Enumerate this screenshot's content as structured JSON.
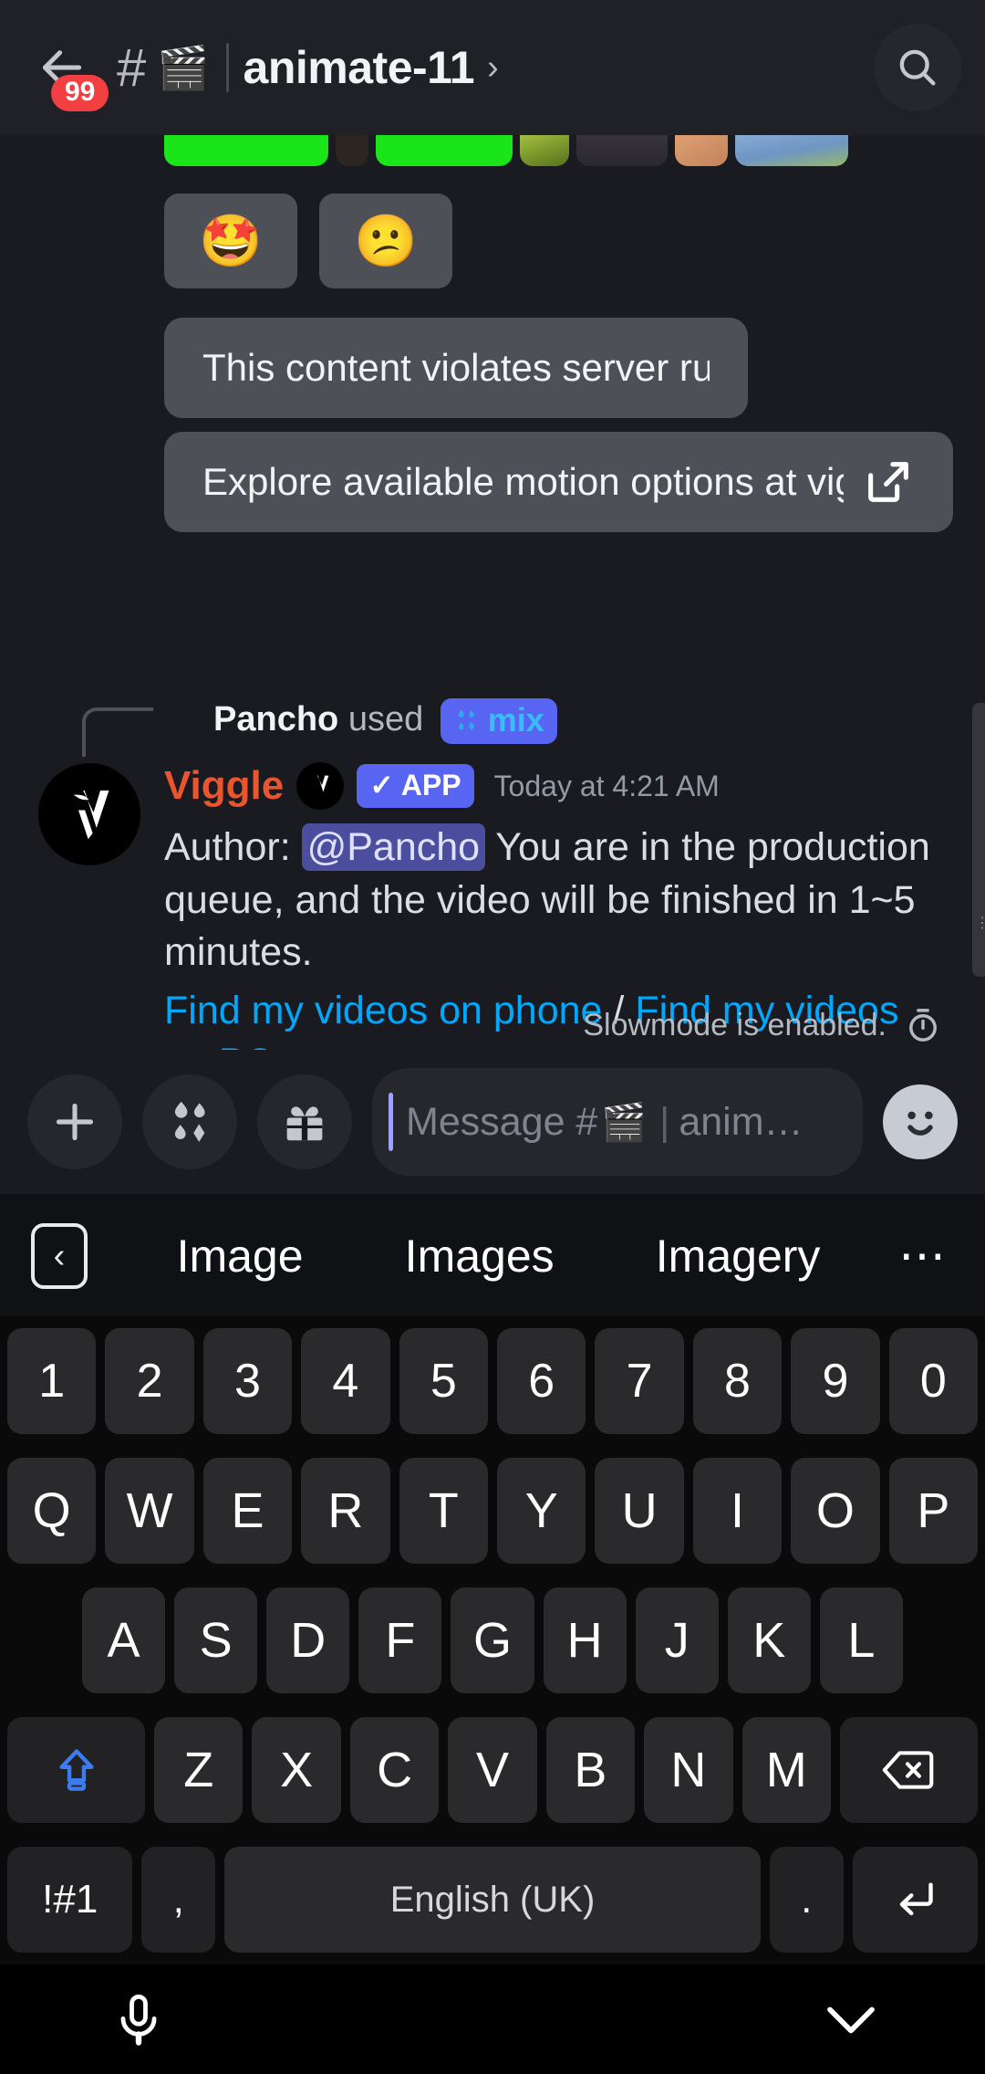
{
  "header": {
    "back_icon": "back-arrow-icon",
    "unread_badge": "99",
    "hash_icon": "#",
    "channel_emoji": "🎬",
    "channel_name": "animate-11",
    "chevron": "›",
    "search_icon": "search-icon"
  },
  "messages": {
    "reactions": [
      {
        "emoji": "🤩",
        "name": "star-struck"
      },
      {
        "emoji": "😕",
        "name": "confused-face"
      }
    ],
    "bubbles": [
      {
        "text": "This content violates server rules",
        "has_link_icon": false
      },
      {
        "text": "Explore available motion options at vigg…",
        "has_link_icon": true
      }
    ],
    "command_used": {
      "user": "Pancho",
      "verb": "used",
      "command": "mix"
    },
    "bot": {
      "name": "Viggle",
      "app_tag": "✓ APP",
      "timestamp": "Today at 4:21 AM",
      "text_prefix": "Author: ",
      "mention": "@Pancho",
      "text_body": " You are in the production queue, and the video will be finished in 1~5 minutes.",
      "link_phone": "Find my videos on phone",
      "link_separator": " / ",
      "link_pc": "Find my videos on PC"
    },
    "slowmode": {
      "text": "Slowmode is enabled.",
      "icon": "stopwatch-icon"
    }
  },
  "input_bar": {
    "add_icon": "plus-icon",
    "apps_icon": "apps-icon",
    "gift_icon": "gift-icon",
    "placeholder_prefix": "Message #",
    "placeholder_emoji": "🎬",
    "placeholder_divider": "|",
    "placeholder_suffix": "anim…",
    "emoji_icon": "smiley-icon"
  },
  "suggestion_bar": {
    "back_icon": "‹",
    "suggestions": [
      "Image",
      "Images",
      "Imagery"
    ],
    "more": "⋯"
  },
  "keyboard": {
    "row_numbers": [
      "1",
      "2",
      "3",
      "4",
      "5",
      "6",
      "7",
      "8",
      "9",
      "0"
    ],
    "row_top": [
      "Q",
      "W",
      "E",
      "R",
      "T",
      "Y",
      "U",
      "I",
      "O",
      "P"
    ],
    "row_home": [
      "A",
      "S",
      "D",
      "F",
      "G",
      "H",
      "J",
      "K",
      "L"
    ],
    "row_bottom": [
      "Z",
      "X",
      "C",
      "V",
      "B",
      "N",
      "M"
    ],
    "shift_label": "shift-icon",
    "backspace_label": "backspace-icon",
    "symbols_label": "!#1",
    "comma_label": ",",
    "space_label": "English (UK)",
    "period_label": ".",
    "enter_label": "enter-icon"
  },
  "nav_bar": {
    "mic_icon": "microphone-icon",
    "hide_keyboard_icon": "chevron-down-icon"
  },
  "colors": {
    "accent_blurple": "#5865f2",
    "brand_red": "#e8552e",
    "link_blue": "#00a8fc",
    "badge_red": "#f23f42",
    "bubble_gray": "#4e5058"
  }
}
